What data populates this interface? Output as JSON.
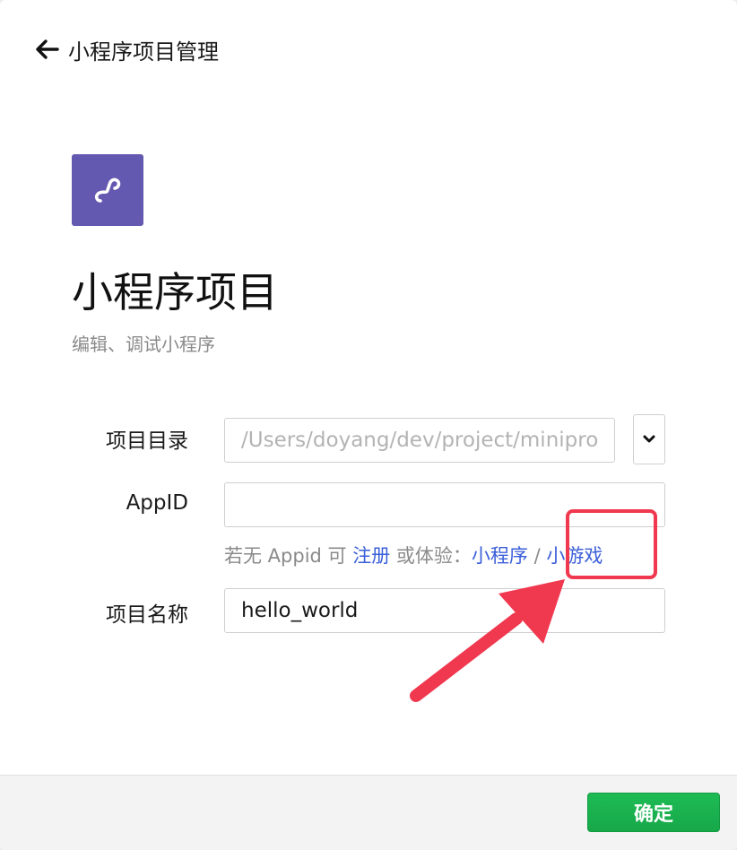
{
  "header": {
    "back_icon": "arrow-left-icon",
    "title": "小程序项目管理"
  },
  "hero": {
    "logo_icon": "mini-program-logo-icon",
    "logo_color": "#6459b0",
    "title": "小程序项目",
    "subtitle": "编辑、调试小程序"
  },
  "form": {
    "directory": {
      "label": "项目目录",
      "placeholder": "/Users/doyang/dev/project/minipro",
      "dropdown_icon": "chevron-down-icon"
    },
    "appid": {
      "label": "AppID",
      "value": ""
    },
    "hint": {
      "prefix": "若无 Appid 可 ",
      "register_link": "注册",
      "middle": " 或体验：",
      "miniprogram_link": "小程序",
      "separator": " / ",
      "minigame_link": "小游戏"
    },
    "project_name": {
      "label": "项目名称",
      "value": "hello_world"
    }
  },
  "annotation": {
    "highlight_color": "#f0384f",
    "arrow_color": "#f0384f"
  },
  "footer": {
    "confirm_label": "确定",
    "confirm_color": "#1aad19"
  }
}
